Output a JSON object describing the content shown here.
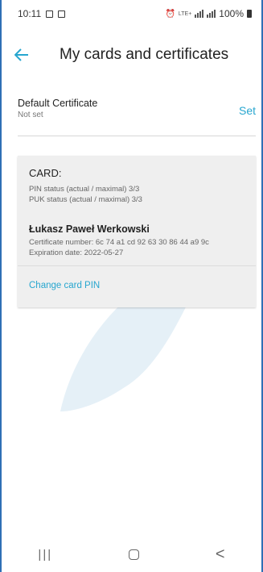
{
  "status_bar": {
    "time": "10:11",
    "network": "LTE+",
    "battery": "100%"
  },
  "header": {
    "back_icon": "arrow-left-icon",
    "title": "My cards and certificates"
  },
  "default_certificate": {
    "label": "Default Certificate",
    "value": "Not set",
    "action": "Set"
  },
  "card": {
    "title": "CARD:",
    "pin_status": "PIN status (actual / maximal) 3/3",
    "puk_status": "PUK status (actual / maximal) 3/3",
    "owner": "Łukasz Paweł Werkowski",
    "certificate_number": "Certificate number: 6c 74 a1 cd 92 63 30 86 44 a9 9c",
    "expiration": "Expiration date: 2022-05-27",
    "change_pin": "Change card PIN"
  },
  "nav": {
    "recent": "|||",
    "back": "<"
  },
  "colors": {
    "accent": "#27a6cf",
    "card_bg": "#efefef"
  }
}
